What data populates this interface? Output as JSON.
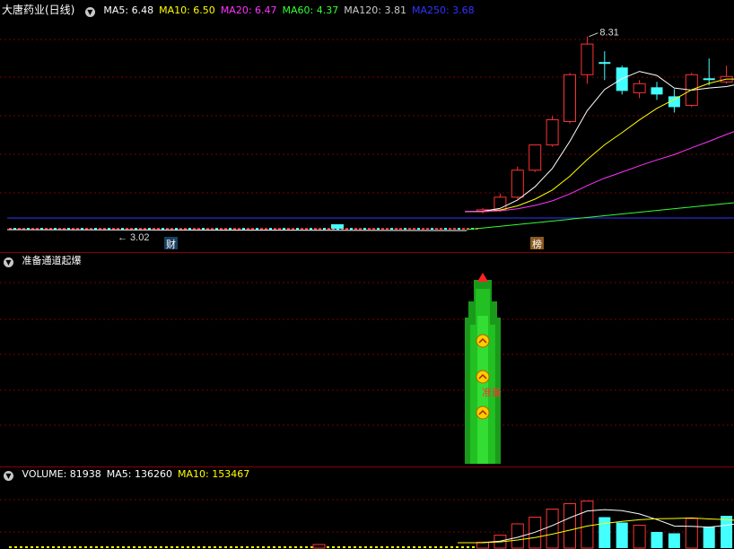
{
  "price_panel": {
    "stock_name": "大唐药业(日线)",
    "ma_labels": [
      {
        "text": "MA5: 6.48",
        "color": "#ffffff"
      },
      {
        "text": "MA10: 6.50",
        "color": "#ffff00"
      },
      {
        "text": "MA20: 6.47",
        "color": "#ff33ff"
      },
      {
        "text": "MA60: 4.37",
        "color": "#33ff33"
      },
      {
        "text": "MA120: 3.81",
        "color": "#cccccc"
      },
      {
        "text": "MA250: 3.68",
        "color": "#3333ff"
      }
    ],
    "high_marker": "8.31",
    "low_marker": "3.02",
    "badge_cai": "财",
    "badge_bang": "榜"
  },
  "indicator_panel": {
    "title": "准备通道起爆",
    "signal_text": "准备"
  },
  "volume_panel": {
    "labels": [
      {
        "text": "VOLUME: 81938",
        "color": "#ffffff"
      },
      {
        "text": "MA5: 136260",
        "color": "#ffffff"
      },
      {
        "text": "MA10: 153467",
        "color": "#ffff00"
      }
    ]
  },
  "colors": {
    "up": "#ff3333",
    "down": "#44ffff",
    "grid": "#7a0000",
    "ma5": "#ffffff",
    "ma10": "#ffff00",
    "ma20": "#ff33ff",
    "ma60": "#33ff33",
    "ma250": "#3333ff"
  },
  "chart_data": {
    "type": "candlestick",
    "price_ylim": [
      2.9,
      8.7
    ],
    "candles": [
      {
        "o": 3.45,
        "h": 3.55,
        "l": 3.4,
        "c": 3.5
      },
      {
        "o": 3.5,
        "h": 3.95,
        "l": 3.45,
        "c": 3.85
      },
      {
        "o": 3.85,
        "h": 4.7,
        "l": 3.8,
        "c": 4.6
      },
      {
        "o": 4.6,
        "h": 5.3,
        "l": 4.55,
        "c": 5.3
      },
      {
        "o": 5.3,
        "h": 6.1,
        "l": 5.25,
        "c": 6.0
      },
      {
        "o": 5.95,
        "h": 7.3,
        "l": 5.9,
        "c": 7.25
      },
      {
        "o": 7.25,
        "h": 8.31,
        "l": 7.0,
        "c": 8.1
      },
      {
        "o": 7.6,
        "h": 7.9,
        "l": 7.1,
        "c": 7.55
      },
      {
        "o": 7.45,
        "h": 7.5,
        "l": 6.7,
        "c": 6.8
      },
      {
        "o": 6.75,
        "h": 7.1,
        "l": 6.6,
        "c": 7.0
      },
      {
        "o": 6.9,
        "h": 7.05,
        "l": 6.55,
        "c": 6.7
      },
      {
        "o": 6.65,
        "h": 6.85,
        "l": 6.2,
        "c": 6.35
      },
      {
        "o": 6.4,
        "h": 7.3,
        "l": 6.35,
        "c": 7.25
      },
      {
        "o": 7.15,
        "h": 7.7,
        "l": 6.95,
        "c": 7.1
      },
      {
        "o": 7.05,
        "h": 7.5,
        "l": 7.0,
        "c": 7.2
      },
      {
        "o": 7.15,
        "h": 7.3,
        "l": 6.95,
        "c": 7.2
      },
      {
        "o": 7.05,
        "h": 7.35,
        "l": 6.8,
        "c": 6.9
      }
    ],
    "volume_ylim": [
      0,
      240000
    ],
    "volumes": [
      {
        "v": 22000,
        "up": true
      },
      {
        "v": 48000,
        "up": true
      },
      {
        "v": 90000,
        "up": true
      },
      {
        "v": 115000,
        "up": true
      },
      {
        "v": 145000,
        "up": true
      },
      {
        "v": 165000,
        "up": true
      },
      {
        "v": 175000,
        "up": true
      },
      {
        "v": 115000,
        "up": false
      },
      {
        "v": 95000,
        "up": false
      },
      {
        "v": 85000,
        "up": true
      },
      {
        "v": 60000,
        "up": false
      },
      {
        "v": 55000,
        "up": false
      },
      {
        "v": 110000,
        "up": true
      },
      {
        "v": 80000,
        "up": false
      },
      {
        "v": 120000,
        "up": false
      },
      {
        "v": 110000,
        "up": true
      },
      {
        "v": 81938,
        "up": false
      }
    ]
  }
}
